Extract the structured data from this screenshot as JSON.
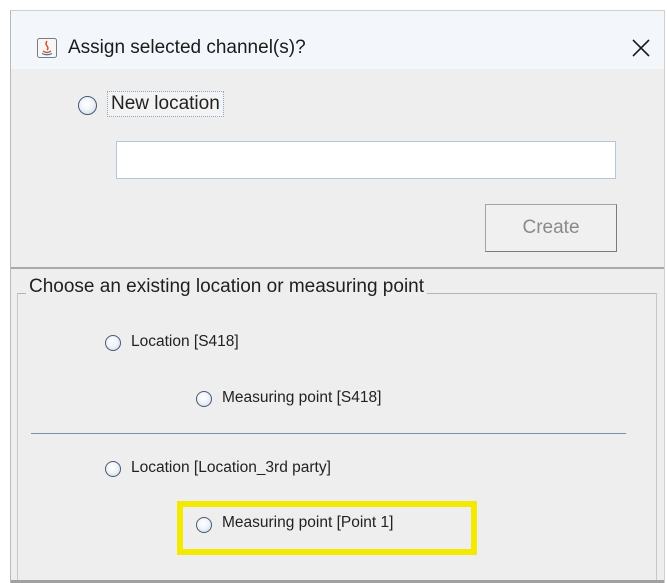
{
  "window": {
    "title": "Assign selected channel(s)?",
    "close_icon": "close-icon",
    "app_icon": "java-app-icon"
  },
  "new_location": {
    "label": "New location",
    "input_value": "",
    "create_label": "Create",
    "create_enabled": false
  },
  "existing": {
    "group_title": "Choose an existing location or measuring point",
    "options": [
      {
        "label": "Location [S418]",
        "selected": false
      },
      {
        "label": "Measuring point [S418]",
        "selected": false
      },
      {
        "label": "Location [Location_3rd party]",
        "selected": false
      },
      {
        "label": "Measuring point [Point 1]",
        "selected": false,
        "highlighted": true
      }
    ]
  },
  "colors": {
    "highlight": "#f2ea00",
    "dialog_bg": "#eeeeee",
    "titlebar_bg": "#f3f7fb"
  }
}
